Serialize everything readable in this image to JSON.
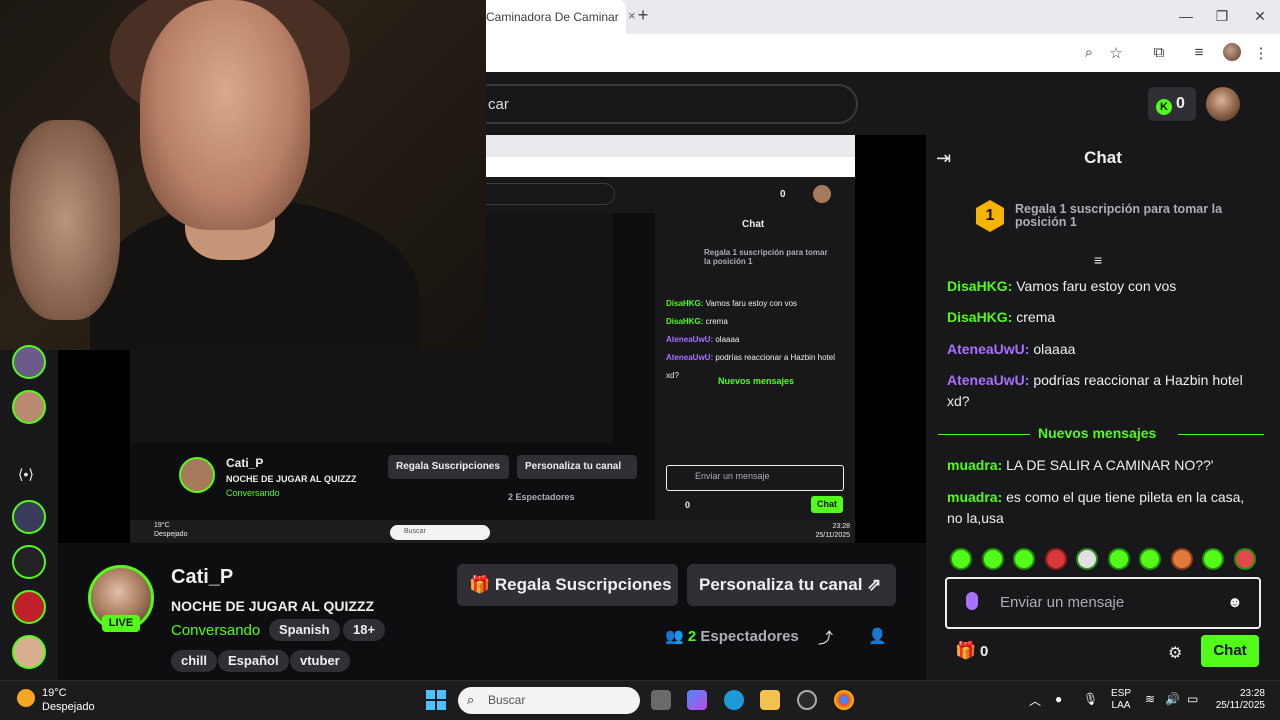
{
  "browser": {
    "tab_title": "Caminadora De Caminar",
    "tab_close": "×",
    "new_tab": "+",
    "window": {
      "minimize": "—",
      "maximize": "❐",
      "close": "✕"
    }
  },
  "header": {
    "search_text": "car",
    "coins": "0"
  },
  "channel": {
    "name": "Cati_P",
    "live": "LIVE",
    "title": "NOCHE DE JUGAR AL QUIZZZ",
    "category": "Conversando",
    "language_chip": "Spanish",
    "age_chip": "18+",
    "tags": [
      "chill",
      "Español",
      "vtuber"
    ],
    "gift_button": "Regala Suscripciones",
    "customize_button": "Personaliza tu canal",
    "viewers_count": "2",
    "viewers_label": "Espectadores"
  },
  "chat": {
    "title": "Chat",
    "pinned_rank": "1",
    "pinned_text": "Regala 1 suscripción para tomar la posición 1",
    "messages": [
      {
        "user": "DisaHKG",
        "text": "Vamos faru estoy con vos",
        "color": "green"
      },
      {
        "user": "DisaHKG",
        "text": "crema",
        "color": "green"
      },
      {
        "user": "AteneaUwU",
        "text": "olaaaa",
        "color": "purple"
      },
      {
        "user": "AteneaUwU",
        "text": "podrías reaccionar a Hazbin hotel xd?",
        "color": "purple"
      },
      {
        "user": "muadra",
        "text": "LA DE SALIR A CAMINAR NO??'",
        "color": "green"
      },
      {
        "user": "muadra",
        "text": "es como el que tiene pileta en la casa, no la,usa",
        "color": "green"
      }
    ],
    "new_messages_label": "Nuevos mensajes",
    "input_placeholder": "Enviar un mensaje",
    "gift_count": "0",
    "send_label": "Chat"
  },
  "nested": {
    "chat_title": "Chat",
    "pinned_text": "Regala 1 suscripción para tomar la posición 1",
    "new_messages_label": "Nuevos mensajes",
    "channel_name": "Cati_P",
    "channel_title": "NOCHE DE JUGAR AL QUIZZZ",
    "category": "Conversando",
    "gift_button": "Regala Suscripciones",
    "customize_button": "Personaliza tu canal",
    "viewers": "2 Espectadores",
    "input_placeholder": "Enviar un mensaje",
    "send_label": "Chat",
    "coins": "0",
    "gift_count": "0",
    "taskbar_search": "Buscar",
    "temp": "19°C",
    "weather": "Despejado",
    "time": "23:28",
    "date": "25/11/2025"
  },
  "taskbar": {
    "temp": "19°C",
    "weather": "Despejado",
    "search": "Buscar",
    "lang_1": "ESP",
    "lang_2": "LAA",
    "time": "23:28",
    "date": "25/11/2025"
  },
  "colors": {
    "kick_green": "#53fc18",
    "purple": "#a970ff",
    "bg": "#0e0e10",
    "panel": "#18181b"
  }
}
